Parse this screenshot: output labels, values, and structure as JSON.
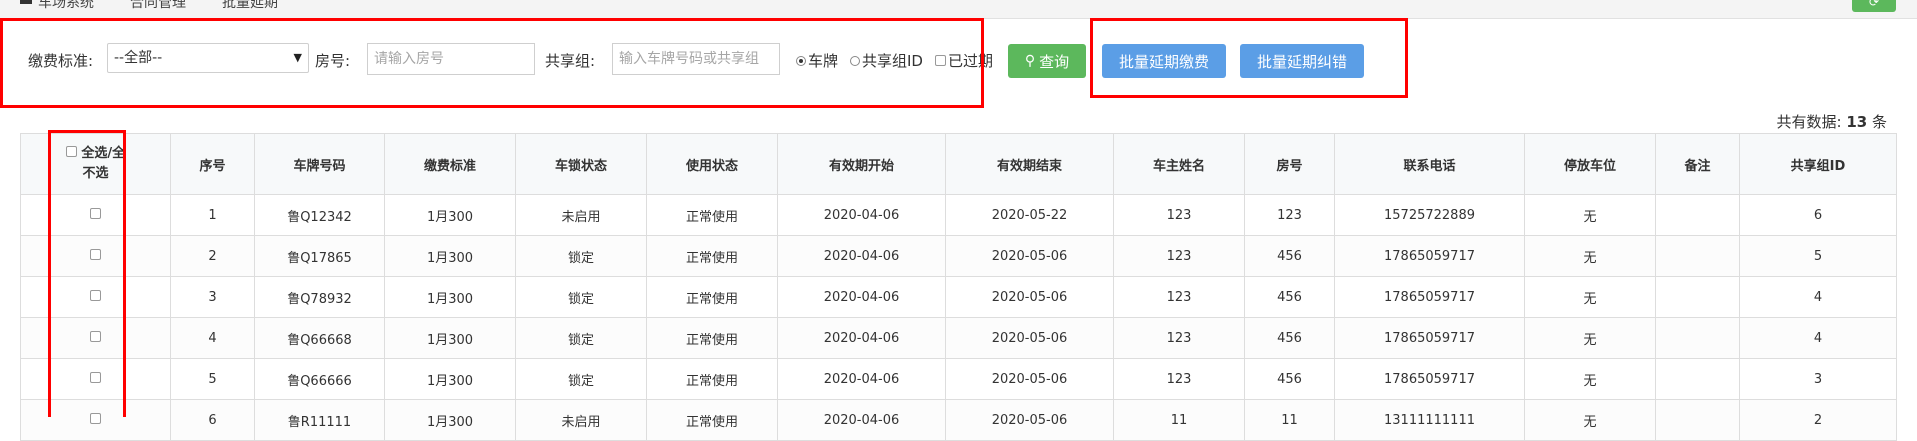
{
  "topbar": {
    "tabs": [
      "车场系统",
      "合同管理",
      "批量延期"
    ],
    "refresh_label": "⟳"
  },
  "filters": {
    "fee_label": "缴费标准:",
    "fee_value": "--全部--",
    "room_label": "房号:",
    "room_placeholder": "请输入房号",
    "group_label": "共享组:",
    "group_placeholder": "输入车牌号码或共享组",
    "radio_plate": "车牌",
    "radio_group": "共享组ID",
    "check_expired": "已过期",
    "search_label": "查询"
  },
  "actions": {
    "batch_pay": "批量延期缴费",
    "batch_fix": "批量延期纠错"
  },
  "summary": {
    "prefix": "共有数据:",
    "count": "13",
    "suffix": "条"
  },
  "table": {
    "select_all_line1": "全选/全",
    "select_all_line2": "不选",
    "headers": [
      "序号",
      "车牌号码",
      "缴费标准",
      "车锁状态",
      "使用状态",
      "有效期开始",
      "有效期结束",
      "车主姓名",
      "房号",
      "联系电话",
      "停放车位",
      "备注",
      "共享组ID"
    ],
    "rows": [
      [
        "1",
        "鲁Q12342",
        "1月300",
        "未启用",
        "正常使用",
        "2020-04-06",
        "2020-05-22",
        "123",
        "123",
        "15725722889",
        "无",
        "",
        "6"
      ],
      [
        "2",
        "鲁Q17865",
        "1月300",
        "锁定",
        "正常使用",
        "2020-04-06",
        "2020-05-06",
        "123",
        "456",
        "17865059717",
        "无",
        "",
        "5"
      ],
      [
        "3",
        "鲁Q78932",
        "1月300",
        "锁定",
        "正常使用",
        "2020-04-06",
        "2020-05-06",
        "123",
        "456",
        "17865059717",
        "无",
        "",
        "4"
      ],
      [
        "4",
        "鲁Q66668",
        "1月300",
        "锁定",
        "正常使用",
        "2020-04-06",
        "2020-05-06",
        "123",
        "456",
        "17865059717",
        "无",
        "",
        "4"
      ],
      [
        "5",
        "鲁Q66666",
        "1月300",
        "锁定",
        "正常使用",
        "2020-04-06",
        "2020-05-06",
        "123",
        "456",
        "17865059717",
        "无",
        "",
        "3"
      ],
      [
        "6",
        "鲁R11111",
        "1月300",
        "未启用",
        "正常使用",
        "2020-04-06",
        "2020-05-06",
        "11",
        "11",
        "13111111111",
        "无",
        "",
        "2"
      ]
    ]
  },
  "colors": {
    "annotation_red": "#ff0000",
    "search_green": "#5cb85c",
    "action_blue": "#5b9ee6"
  }
}
